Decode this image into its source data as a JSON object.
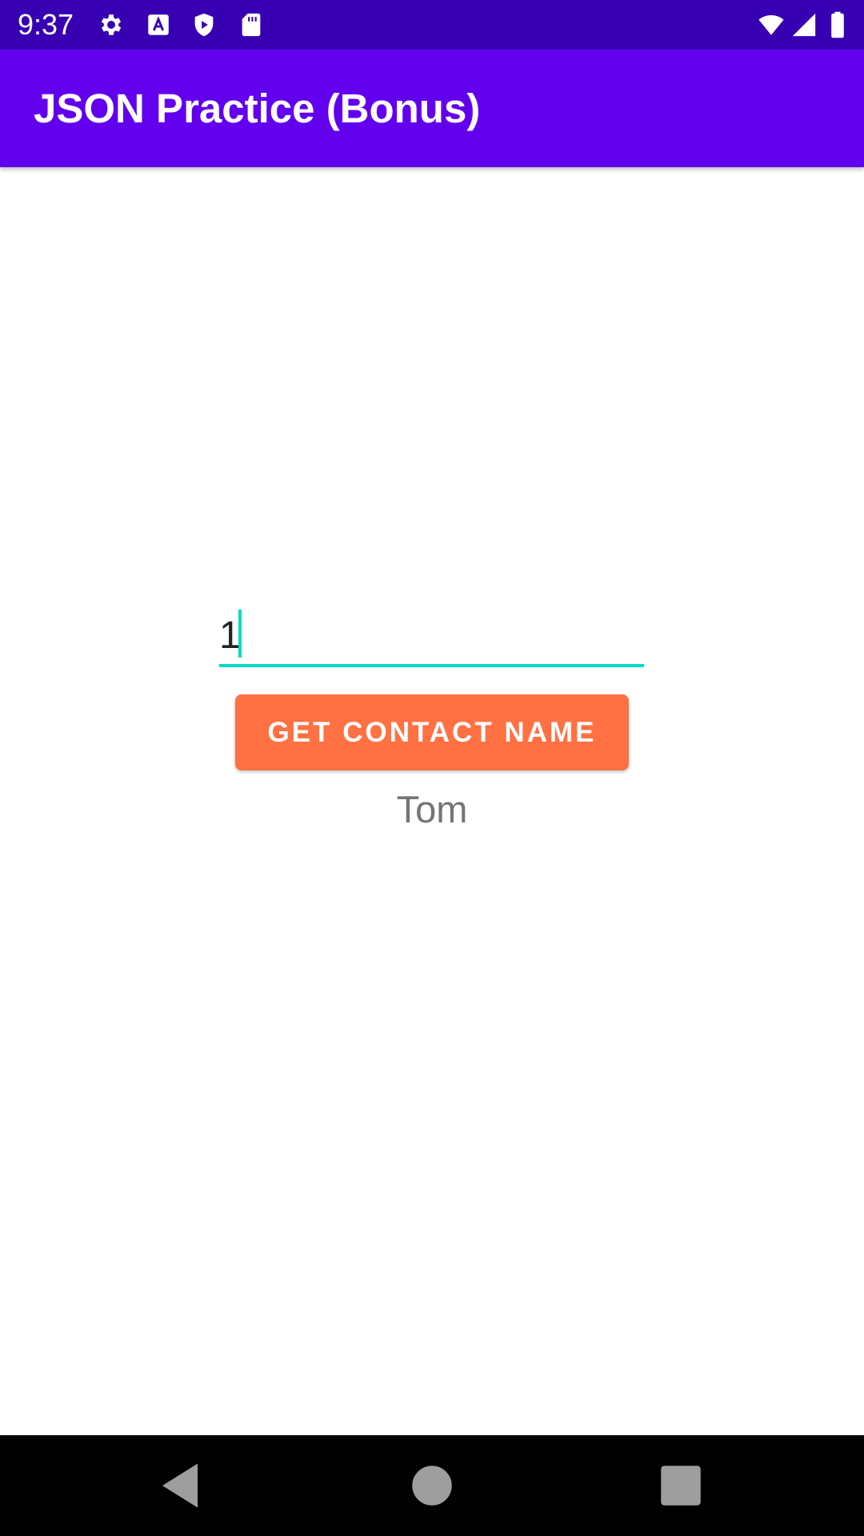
{
  "status_bar": {
    "time": "9:37",
    "icons": [
      "gear-icon",
      "text-a-icon",
      "shield-play-icon",
      "sd-card-icon",
      "wifi-icon",
      "signal-icon",
      "battery-icon"
    ]
  },
  "app_bar": {
    "title": "JSON Practice (Bonus)"
  },
  "form": {
    "input_value": "1",
    "button_label": "GET CONTACT NAME",
    "result": "Tom"
  },
  "navigation": {
    "icons": [
      "back-icon",
      "home-icon",
      "recents-icon"
    ]
  },
  "colors": {
    "status_bar": "#3700b3",
    "app_bar": "#6200ee",
    "accent": "#03dac5",
    "button": "#ff7043",
    "result_text": "#757575"
  }
}
